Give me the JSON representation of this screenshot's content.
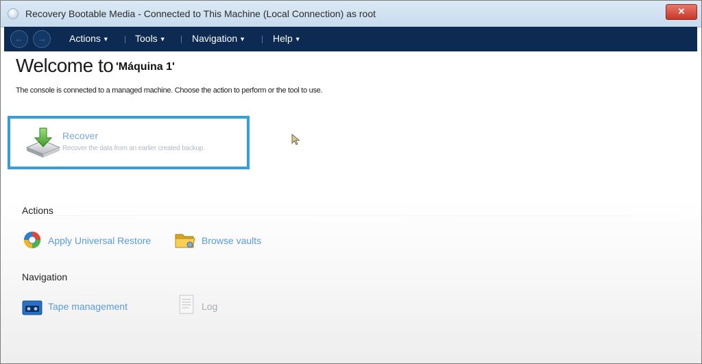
{
  "window": {
    "title": "Recovery Bootable Media - Connected to This Machine (Local Connection) as root",
    "close_label": "✕"
  },
  "nav": {
    "back": "←",
    "forward": "→"
  },
  "menu": {
    "items": [
      {
        "label": "Actions"
      },
      {
        "label": "Tools"
      },
      {
        "label": "Navigation"
      },
      {
        "label": "Help"
      }
    ],
    "chevron": "▼"
  },
  "main": {
    "welcome": "Welcome to",
    "machine": "'Máquina 1'",
    "intro": "The console is connected to a managed machine. Choose the action to perform or the tool to use.",
    "recover": {
      "title": "Recover",
      "description": "Recover the data from an earlier created backup.",
      "highlight_color": "#2f9fe0"
    }
  },
  "actions": {
    "heading": "Actions",
    "items": [
      {
        "label": "Apply Universal Restore",
        "icon": "universal-restore-icon"
      },
      {
        "label": "Browse vaults",
        "icon": "folder-icon"
      }
    ]
  },
  "navigation": {
    "heading": "Navigation",
    "items": [
      {
        "label": "Tape management",
        "icon": "tape-icon"
      },
      {
        "label": "Log",
        "icon": "log-icon"
      }
    ]
  },
  "colors": {
    "menubar": "#0c2a52",
    "link": "#5b9bd5"
  }
}
